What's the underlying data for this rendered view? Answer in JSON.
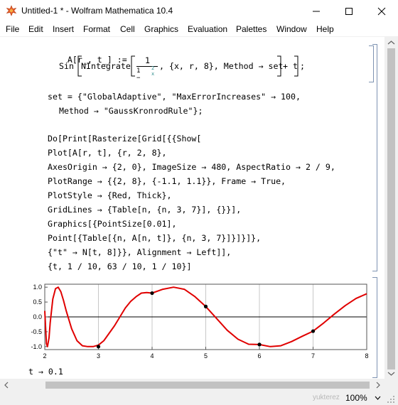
{
  "window": {
    "title": "Untitled-1 * - Wolfram Mathematica 10.4"
  },
  "menu": [
    "File",
    "Edit",
    "Insert",
    "Format",
    "Cell",
    "Graphics",
    "Evaluation",
    "Palettes",
    "Window",
    "Help"
  ],
  "code": {
    "def_head": "A[r_, t_] :=",
    "def_sin": "Sin",
    "def_nintegrate": "NIntegrate",
    "def_frac_num": "1",
    "def_frac_den_a": "1 −",
    "def_frac_den_small_num": "2",
    "def_frac_den_small_den": "x",
    "def_args": ", {x, r, 8}, Method → set",
    "def_tail": "+ t",
    "def_semicolon": ";",
    "set_line1": "set = {\"GlobalAdaptive\", \"MaxErrorIncreases\" → 100,",
    "set_line2": "Method → \"GaussKronrodRule\"};",
    "do_lines": [
      "Do[Print[Rasterize[Grid[{{Show[",
      "Plot[A[r, t], {r, 2, 8},",
      "AxesOrigin → {2, 0}, ImageSize → 480, AspectRatio → 2 / 9,",
      "PlotRange → {{2, 8}, {-1.1, 1.1}}, Frame → True,",
      "PlotStyle → {Red, Thick},",
      "GridLines → {Table[n, {n, 3, 7}], {}}],",
      "Graphics[{PointSize[0.01],",
      "Point[{Table[{n, A[n, t]}, {n, 3, 7}]}]}]},",
      "{\"t\" → N[t, 8]}}, Alignment → Left]],",
      "{t, 1 / 10, 63 / 10, 1 / 10}]"
    ]
  },
  "output": {
    "label": "t → 0.1"
  },
  "status": {
    "watermark": "yukterez",
    "zoom": "100%"
  },
  "chart_data": {
    "type": "line",
    "title": "",
    "xlabel": "",
    "ylabel": "",
    "xlim": [
      2,
      8
    ],
    "ylim": [
      -1.1,
      1.1
    ],
    "x_ticks": [
      "2",
      "3",
      "4",
      "5",
      "6",
      "7",
      "8"
    ],
    "y_ticks": [
      "1.0",
      "0.5",
      "0.0",
      "-0.5",
      "-1.0"
    ],
    "series": [
      {
        "color": "#e00000",
        "x": [
          2.0,
          2.03,
          2.05,
          2.08,
          2.1,
          2.15,
          2.2,
          2.25,
          2.3,
          2.35,
          2.4,
          2.5,
          2.6,
          2.7,
          2.8,
          2.9,
          3.0,
          3.1,
          3.2,
          3.3,
          3.4,
          3.5,
          3.6,
          3.7,
          3.8,
          3.9,
          4.0,
          4.2,
          4.4,
          4.6,
          4.8,
          5.0,
          5.2,
          5.4,
          5.6,
          5.8,
          6.0,
          6.2,
          6.4,
          6.6,
          6.8,
          7.0,
          7.2,
          7.4,
          7.6,
          7.8,
          8.0
        ],
        "y": [
          0.2,
          -0.9,
          -1.0,
          -0.7,
          -0.2,
          0.6,
          0.95,
          1.0,
          0.85,
          0.55,
          0.2,
          -0.4,
          -0.8,
          -0.97,
          -1.0,
          -1.0,
          -0.95,
          -0.8,
          -0.55,
          -0.3,
          0.0,
          0.3,
          0.52,
          0.68,
          0.8,
          0.82,
          0.8,
          0.93,
          1.0,
          0.93,
          0.68,
          0.35,
          -0.05,
          -0.45,
          -0.75,
          -0.92,
          -0.93,
          -1.0,
          -0.97,
          -0.83,
          -0.65,
          -0.48,
          -0.2,
          0.1,
          0.38,
          0.62,
          0.78
        ]
      }
    ],
    "points": [
      {
        "x": 3,
        "y": -1.0
      },
      {
        "x": 4,
        "y": 0.8
      },
      {
        "x": 5,
        "y": 0.35
      },
      {
        "x": 6,
        "y": -0.93
      },
      {
        "x": 7,
        "y": -0.48
      }
    ],
    "gridlines_x": [
      3,
      4,
      5,
      6,
      7
    ],
    "frame": true
  }
}
